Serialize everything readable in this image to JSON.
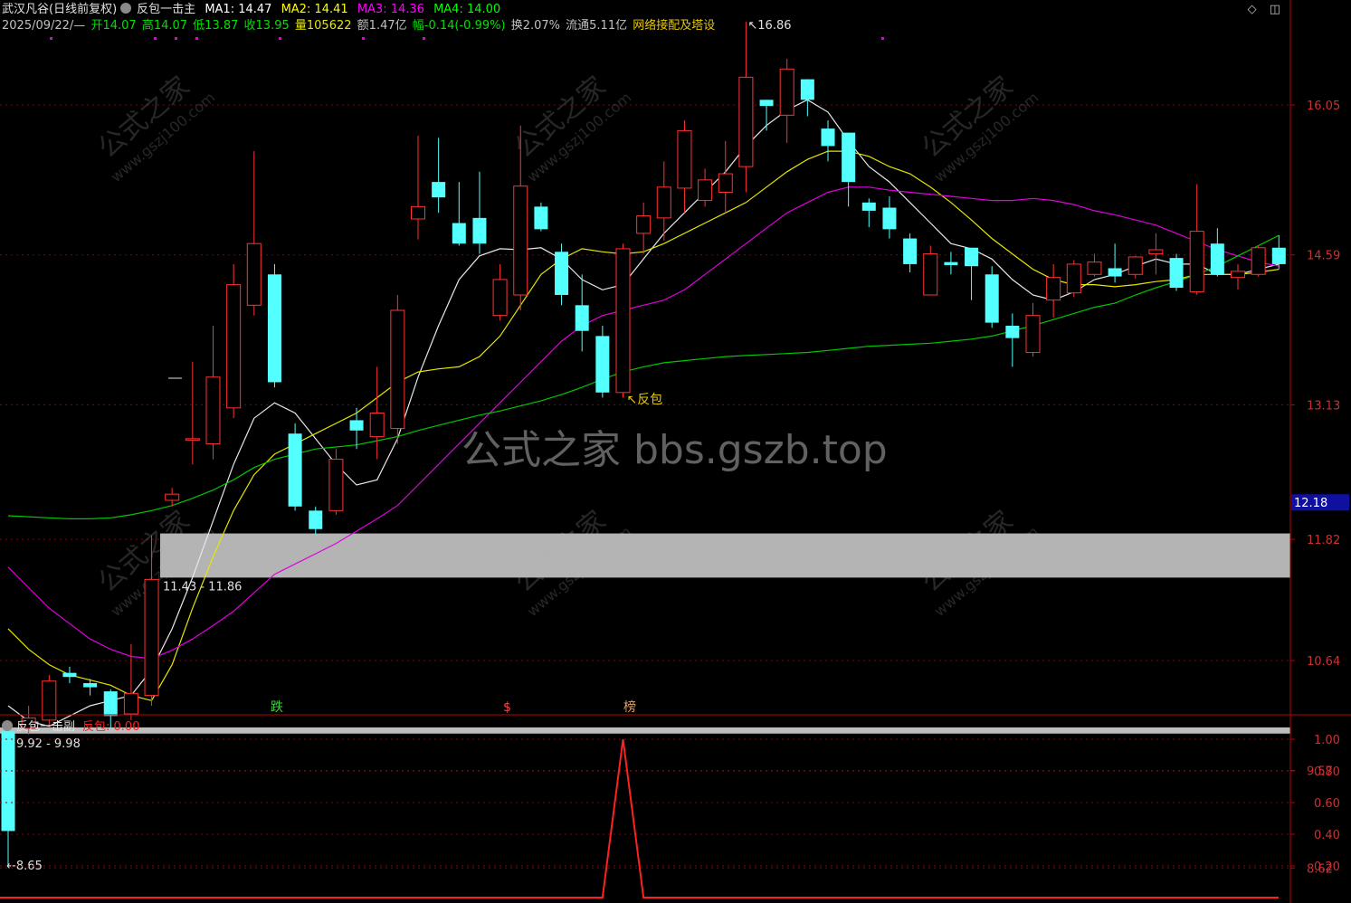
{
  "header": {
    "stock_name": "武汉凡谷(日线前复权)",
    "indicator_name": "反包一击主",
    "ma1": "MA1: 14.47",
    "ma2": "MA2: 14.41",
    "ma3": "MA3: 14.36",
    "ma4": "MA4: 14.00",
    "date": "2025/09/22/—",
    "open": "开14.07",
    "high": "高14.07",
    "low": "低13.87",
    "close": "收13.95",
    "volume": "量105622",
    "amount": "额1.47亿",
    "change": "幅-0.14(-0.99%)",
    "turnover": "换2.07%",
    "float": "流通5.11亿",
    "concept": "网络接配及塔设"
  },
  "sub": {
    "indicator_name": "反包一击副",
    "value_label": "反包: 0.00"
  },
  "watermark": "公式之家 bbs.gszb.top",
  "watermark_small": [
    "公式之家",
    "www.gszj100.com"
  ],
  "colors": {
    "up": "#ff3232",
    "down": "#54ffff",
    "ma1": "#e8e8e8",
    "ma2": "#e6e600",
    "ma3": "#e000e0",
    "ma4": "#00c800",
    "grid": "#8b0000",
    "axis": "#c00000",
    "signal": "#ff2020",
    "last_price_bg": "#1010a0"
  },
  "chart_data": {
    "type": "candlestick",
    "y_ticks": [
      "16.05",
      "14.59",
      "13.13",
      "11.82",
      "10.64",
      "9.57",
      "8.62"
    ],
    "last_price_label": "12.18",
    "annotations": {
      "high_label": "16.86",
      "low_label": "8.65",
      "reversal_label": "反包",
      "zone_upper_label": "11.43 - 11.86",
      "zone_lower_label": "9.92 - 9.98",
      "markers": [
        "跌",
        "$",
        "榜"
      ]
    },
    "zones": [
      {
        "name": "upper",
        "from": 11.43,
        "to": 11.86
      },
      {
        "name": "lower",
        "from": 9.92,
        "to": 9.98
      }
    ],
    "candles": [
      [
        9.95,
        8.98,
        10.02,
        8.65
      ],
      [
        9.98,
        10.08,
        10.2,
        9.92
      ],
      [
        10.06,
        10.44,
        10.5,
        10.0
      ],
      [
        10.52,
        10.48,
        10.58,
        10.42
      ],
      [
        10.42,
        10.38,
        10.46,
        10.3
      ],
      [
        10.34,
        10.1,
        10.36,
        9.98
      ],
      [
        10.12,
        10.32,
        10.8,
        10.06
      ],
      [
        10.3,
        11.43,
        11.86,
        10.2
      ],
      [
        12.2,
        12.26,
        12.32,
        12.14
      ],
      [
        12.8,
        12.8,
        13.55,
        12.55
      ],
      [
        12.75,
        13.4,
        13.9,
        12.6
      ],
      [
        13.1,
        14.3,
        14.5,
        13.0
      ],
      [
        14.1,
        14.7,
        15.6,
        14.0
      ],
      [
        14.4,
        13.35,
        14.5,
        13.3
      ],
      [
        12.85,
        12.14,
        12.95,
        12.1
      ],
      [
        12.1,
        11.92,
        12.14,
        11.86
      ],
      [
        12.1,
        12.6,
        12.7,
        12.06
      ],
      [
        12.98,
        12.88,
        13.1,
        12.7
      ],
      [
        12.82,
        13.05,
        13.5,
        12.6
      ],
      [
        12.9,
        14.05,
        14.2,
        12.75
      ],
      [
        14.94,
        15.06,
        15.75,
        14.74
      ],
      [
        15.3,
        15.15,
        15.73,
        15.0
      ],
      [
        14.9,
        14.7,
        15.3,
        14.68
      ],
      [
        14.95,
        14.7,
        15.4,
        14.6
      ],
      [
        14.0,
        14.35,
        14.5,
        13.95
      ],
      [
        14.2,
        15.26,
        15.85,
        14.05
      ],
      [
        15.06,
        14.84,
        15.1,
        14.82
      ],
      [
        14.62,
        14.2,
        14.7,
        14.1
      ],
      [
        14.1,
        13.85,
        14.4,
        13.65
      ],
      [
        13.8,
        13.25,
        13.9,
        13.2
      ],
      [
        13.25,
        14.65,
        14.7,
        13.2
      ],
      [
        14.8,
        14.97,
        15.1,
        14.6
      ],
      [
        14.95,
        15.25,
        15.5,
        14.73
      ],
      [
        15.24,
        15.8,
        15.9,
        15.0
      ],
      [
        15.12,
        15.32,
        15.43,
        15.06
      ],
      [
        15.2,
        15.38,
        15.7,
        15.0
      ],
      [
        15.45,
        16.32,
        16.86,
        15.2
      ],
      [
        16.1,
        16.04,
        16.1,
        15.8
      ],
      [
        15.95,
        16.4,
        16.5,
        15.68
      ],
      [
        16.3,
        16.1,
        16.3,
        15.94
      ],
      [
        15.82,
        15.65,
        15.9,
        15.5
      ],
      [
        15.78,
        15.3,
        15.78,
        15.06
      ],
      [
        15.1,
        15.02,
        15.14,
        14.86
      ],
      [
        15.05,
        14.84,
        15.16,
        14.75
      ],
      [
        14.75,
        14.5,
        14.8,
        14.42
      ],
      [
        14.2,
        14.6,
        14.68,
        14.2
      ],
      [
        14.52,
        14.49,
        14.62,
        14.4
      ],
      [
        14.66,
        14.48,
        14.66,
        14.15
      ],
      [
        14.4,
        13.93,
        14.48,
        13.88
      ],
      [
        13.9,
        13.78,
        14.02,
        13.5
      ],
      [
        13.64,
        14.0,
        14.12,
        13.6
      ],
      [
        14.15,
        14.37,
        14.5,
        13.98
      ],
      [
        14.22,
        14.5,
        14.54,
        14.18
      ],
      [
        14.4,
        14.52,
        14.6,
        14.38
      ],
      [
        14.46,
        14.38,
        14.7,
        14.32
      ],
      [
        14.4,
        14.57,
        14.58,
        14.36
      ],
      [
        14.6,
        14.64,
        14.8,
        14.4
      ],
      [
        14.56,
        14.27,
        14.6,
        14.24
      ],
      [
        14.23,
        14.82,
        15.28,
        14.2
      ],
      [
        14.7,
        14.4,
        14.85,
        14.38
      ],
      [
        14.37,
        14.43,
        14.5,
        14.25
      ],
      [
        14.4,
        14.66,
        14.68,
        14.38
      ],
      [
        14.66,
        14.5,
        14.78,
        14.45
      ]
    ],
    "ma_series": [
      {
        "name": "MA1",
        "values": [
          10.2,
          10.05,
          10.0,
          10.1,
          10.2,
          10.25,
          10.3,
          10.55,
          10.95,
          11.45,
          12.0,
          12.55,
          13.0,
          13.15,
          13.05,
          12.8,
          12.55,
          12.35,
          12.4,
          12.8,
          13.4,
          13.9,
          14.35,
          14.58,
          14.65,
          14.64,
          14.66,
          14.55,
          14.35,
          14.25,
          14.3,
          14.55,
          14.8,
          15.0,
          15.2,
          15.4,
          15.65,
          15.85,
          16.0,
          16.1,
          15.98,
          15.7,
          15.45,
          15.3,
          15.1,
          14.9,
          14.7,
          14.65,
          14.55,
          14.35,
          14.2,
          14.15,
          14.23,
          14.35,
          14.4,
          14.48,
          14.55,
          14.5,
          14.5,
          14.4,
          14.4,
          14.45,
          14.5
        ]
      },
      {
        "name": "MA2",
        "values": [
          10.95,
          10.75,
          10.6,
          10.5,
          10.45,
          10.4,
          10.3,
          10.25,
          10.6,
          11.15,
          11.65,
          12.1,
          12.45,
          12.65,
          12.75,
          12.85,
          12.95,
          13.05,
          13.2,
          13.35,
          13.45,
          13.48,
          13.5,
          13.6,
          13.8,
          14.1,
          14.4,
          14.55,
          14.65,
          14.62,
          14.6,
          14.62,
          14.7,
          14.8,
          14.9,
          15.0,
          15.1,
          15.25,
          15.4,
          15.52,
          15.6,
          15.6,
          15.55,
          15.45,
          15.38,
          15.25,
          15.1,
          14.93,
          14.75,
          14.6,
          14.45,
          14.35,
          14.3,
          14.3,
          14.28,
          14.3,
          14.33,
          14.35,
          14.4,
          14.4,
          14.4,
          14.42,
          14.45
        ]
      },
      {
        "name": "MA3",
        "values": [
          11.55,
          11.35,
          11.15,
          11.0,
          10.85,
          10.75,
          10.68,
          10.66,
          10.74,
          10.85,
          10.98,
          11.12,
          11.3,
          11.48,
          11.58,
          11.68,
          11.78,
          11.9,
          12.02,
          12.15,
          12.35,
          12.55,
          12.75,
          12.95,
          13.15,
          13.35,
          13.55,
          13.75,
          13.9,
          14.0,
          14.05,
          14.1,
          14.15,
          14.25,
          14.4,
          14.55,
          14.7,
          14.85,
          15.0,
          15.1,
          15.2,
          15.25,
          15.25,
          15.22,
          15.2,
          15.18,
          15.16,
          15.14,
          15.12,
          15.12,
          15.14,
          15.12,
          15.08,
          15.02,
          14.98,
          14.93,
          14.88,
          14.8,
          14.72,
          14.64,
          14.58,
          14.52,
          14.48
        ]
      },
      {
        "name": "MA4",
        "values": [
          12.05,
          12.04,
          12.03,
          12.02,
          12.02,
          12.03,
          12.06,
          12.1,
          12.15,
          12.22,
          12.3,
          12.4,
          12.52,
          12.6,
          12.65,
          12.7,
          12.72,
          12.74,
          12.78,
          12.82,
          12.88,
          12.93,
          12.98,
          13.03,
          13.07,
          13.12,
          13.17,
          13.23,
          13.3,
          13.38,
          13.45,
          13.5,
          13.54,
          13.56,
          13.58,
          13.6,
          13.61,
          13.62,
          13.63,
          13.64,
          13.66,
          13.68,
          13.7,
          13.71,
          13.72,
          13.73,
          13.75,
          13.77,
          13.8,
          13.85,
          13.9,
          13.96,
          14.02,
          14.08,
          14.12,
          14.2,
          14.27,
          14.33,
          14.4,
          14.48,
          14.58,
          14.68,
          14.78
        ]
      }
    ],
    "sub_chart": {
      "type": "line",
      "name": "反包",
      "y_ticks": [
        "1.00",
        "0.80",
        "0.60",
        "0.40",
        "0.20"
      ],
      "ylim": [
        0,
        1
      ],
      "signal_index": 30,
      "signal_value": 1.0
    }
  }
}
